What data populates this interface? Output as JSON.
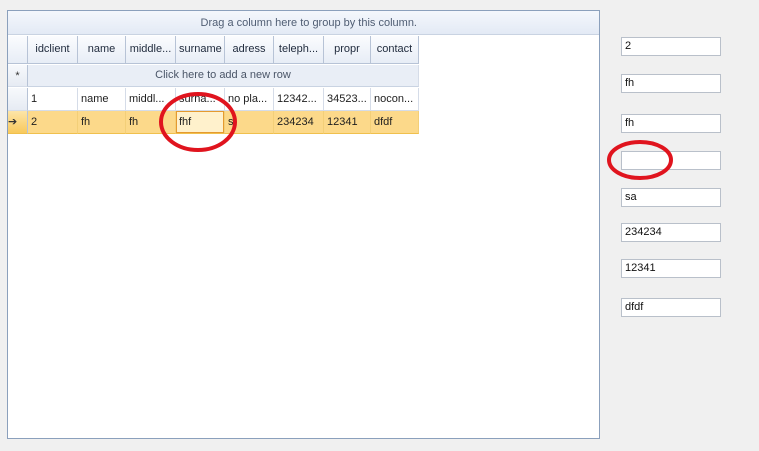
{
  "grid": {
    "group_panel_text": "Drag a column here to group by this column.",
    "columns": [
      "idclient",
      "name",
      "middle...",
      "surname",
      "adress",
      "teleph...",
      "propr",
      "contact"
    ],
    "new_row_text": "Click here to add a new row",
    "new_row_marker": "*",
    "current_row_marker": "➔",
    "rows": [
      {
        "idclient": "1",
        "name": "name",
        "middle": "middl...",
        "surname": "surna...",
        "adress": "no pla...",
        "telephone": "12342...",
        "propr": "34523...",
        "contact": "nocon..."
      },
      {
        "idclient": "2",
        "name": "fh",
        "middle": "fh",
        "surname": "fhf",
        "adress": "s",
        "telephone": "234234",
        "propr": "12341",
        "contact": "dfdf"
      }
    ]
  },
  "detail_fields": [
    "2",
    "fh",
    "fh",
    "",
    "sa",
    "234234",
    "12341",
    "dfdf"
  ],
  "colors": {
    "selected_row": "#fcd98a",
    "annotation": "#e0141e",
    "grid_border": "#8ba0bc"
  }
}
